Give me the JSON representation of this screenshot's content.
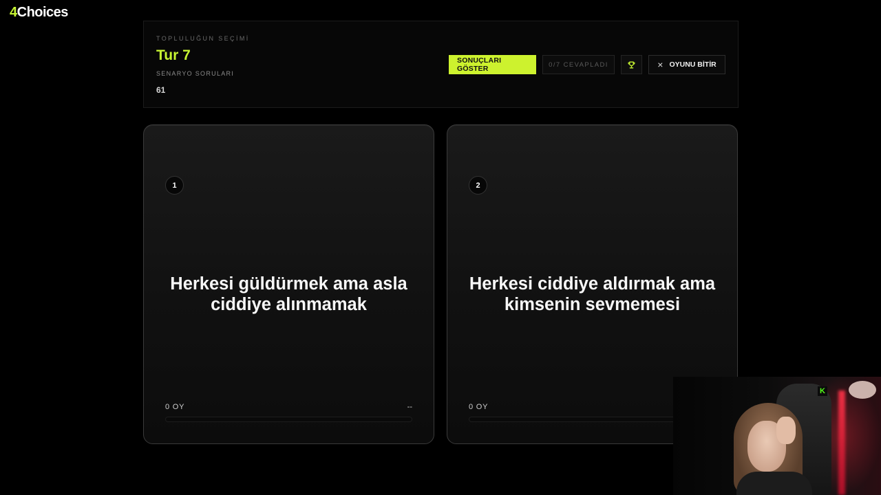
{
  "logo": {
    "number": "4",
    "word": "Choices"
  },
  "header": {
    "eyebrow": "TOPLULUĞUN SEÇİMİ",
    "round_title": "Tur 7",
    "subtitle": "SENARYO SORULARI",
    "count": "61"
  },
  "actions": {
    "show_results_label": "SONUÇLARI GÖSTER",
    "answered_status": "0/7 CEVAPLADI",
    "leaderboard_icon": "trophy-icon",
    "end_game_label": "OYUNU BİTİR",
    "end_game_icon": "×"
  },
  "options": [
    {
      "number": "1",
      "text": "Herkesi güldürmek ama asla ciddiye alınmamak",
      "votes_label": "0 OY",
      "percent_label": "--",
      "percent": 0
    },
    {
      "number": "2",
      "text": "Herkesi ciddiye aldırmak ama kimsenin sevmemesi",
      "votes_label": "0 OY",
      "percent": 0
    }
  ],
  "colors": {
    "accent": "#c6f432",
    "background": "#000000"
  }
}
